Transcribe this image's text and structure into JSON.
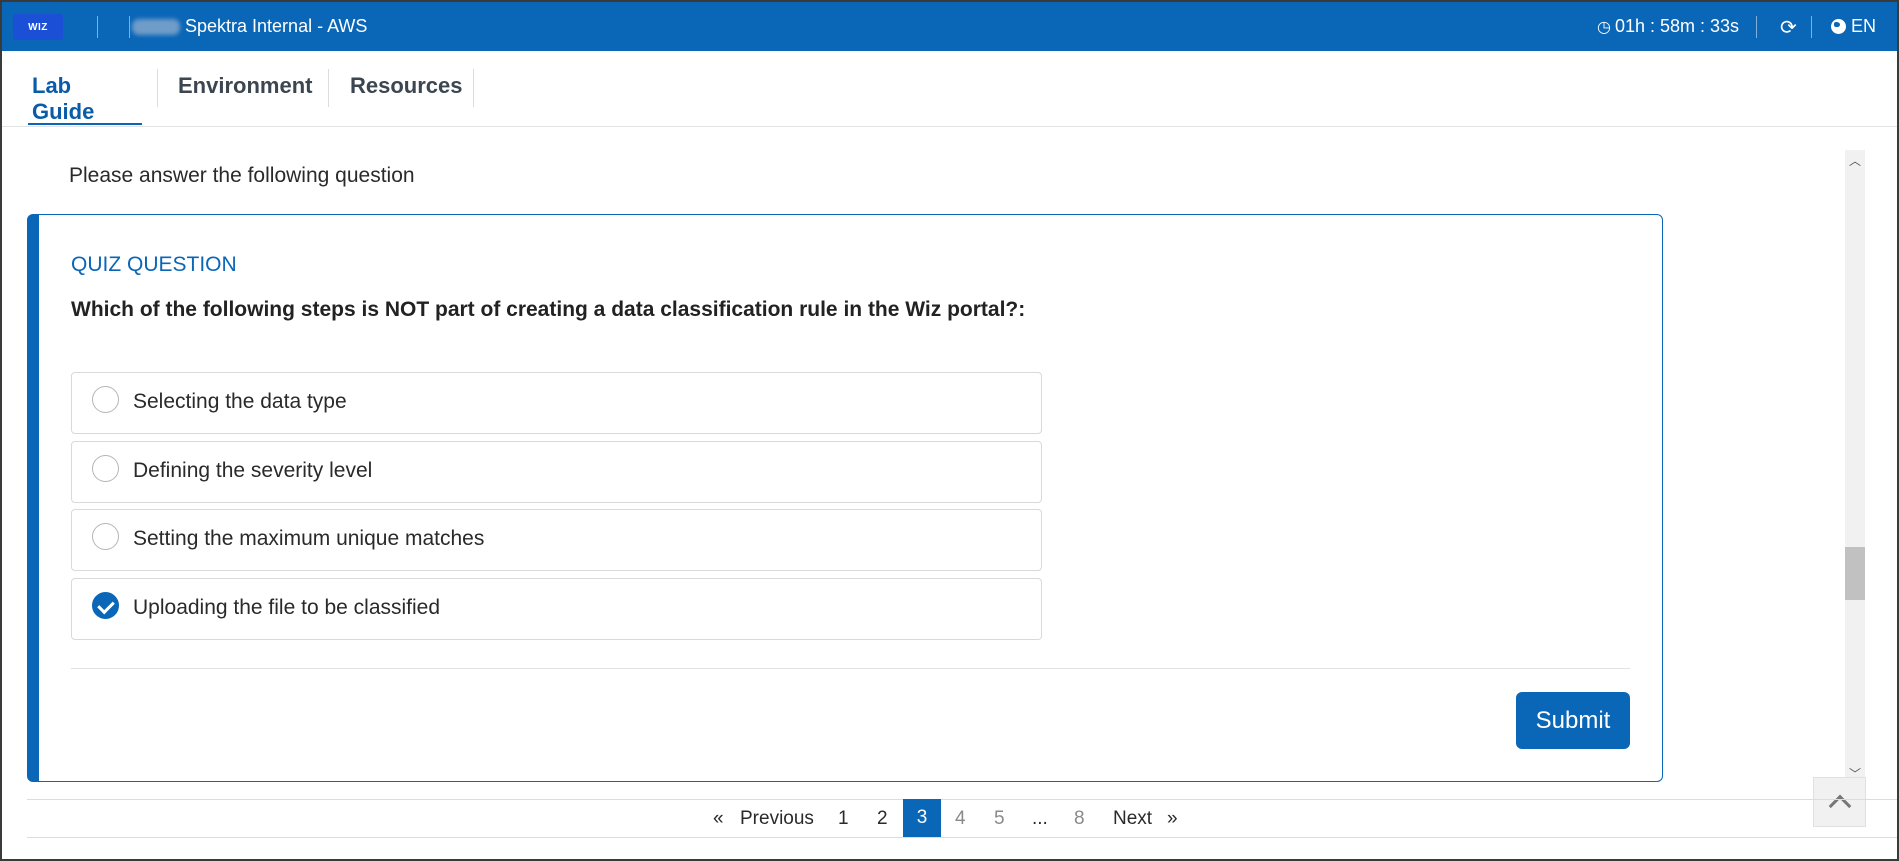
{
  "header": {
    "logo_text": "WIZ",
    "app_title": "Spektra Internal - AWS",
    "timer": "01h : 58m : 33s",
    "language": "EN"
  },
  "tabs": [
    {
      "label": "Lab Guide",
      "active": true
    },
    {
      "label": "Environment",
      "active": false
    },
    {
      "label": "Resources",
      "active": false
    }
  ],
  "content": {
    "prompt": "Please answer the following question",
    "quiz": {
      "label": "QUIZ QUESTION",
      "question": "Which of the following steps is NOT part of creating a data classification rule in the Wiz portal?:",
      "options": [
        {
          "text": "Selecting the data type",
          "selected": false
        },
        {
          "text": "Defining the severity level",
          "selected": false
        },
        {
          "text": "Setting the maximum unique matches",
          "selected": false
        },
        {
          "text": "Uploading the file to be classified",
          "selected": true
        }
      ],
      "submit_label": "Submit"
    }
  },
  "pagination": {
    "previous_label": "Previous",
    "next_label": "Next",
    "prev_arrow": "«",
    "next_arrow": "»",
    "pages": [
      "1",
      "2",
      "3",
      "4",
      "5",
      "...",
      "8"
    ],
    "current_page": "3"
  },
  "colors": {
    "primary": "#0a66b7",
    "topbar": "#0a66b7"
  }
}
